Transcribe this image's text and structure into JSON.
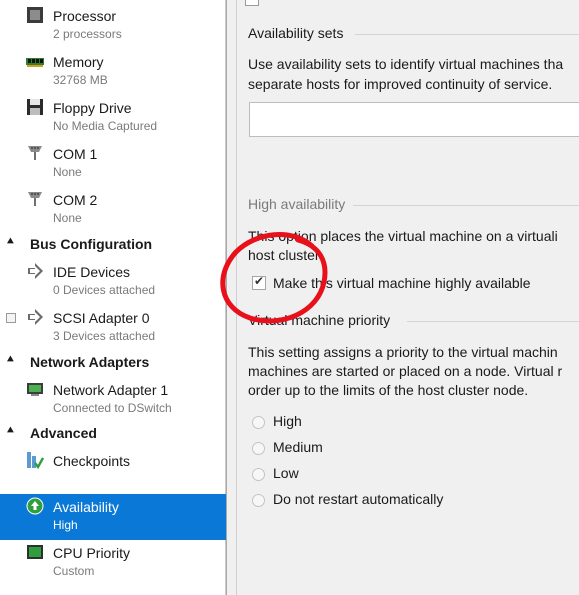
{
  "nav": {
    "processor": {
      "label": "Processor",
      "sub": "2 processors",
      "icon": "processor-icon"
    },
    "memory": {
      "label": "Memory",
      "sub": "32768 MB",
      "icon": "memory-icon"
    },
    "floppy": {
      "label": "Floppy Drive",
      "sub": "No Media Captured",
      "icon": "floppy-icon"
    },
    "com1": {
      "label": "COM 1",
      "sub": "None",
      "icon": "serial-port-icon"
    },
    "com2": {
      "label": "COM 2",
      "sub": "None",
      "icon": "serial-port-icon"
    },
    "bus_header": "Bus Configuration",
    "ide": {
      "label": "IDE Devices",
      "sub": "0 Devices attached",
      "icon": "ide-icon"
    },
    "scsi": {
      "label": "SCSI Adapter 0",
      "sub": "3 Devices attached",
      "icon": "scsi-icon"
    },
    "network_header": "Network Adapters",
    "netadapter": {
      "label": "Network Adapter 1",
      "sub": "Connected to DSwitch",
      "icon": "network-adapter-icon"
    },
    "advanced_header": "Advanced",
    "checkpoints": {
      "label": "Checkpoints",
      "sub": "",
      "icon": "checkpoints-icon"
    },
    "availability": {
      "label": "Availability",
      "sub": "High",
      "icon": "availability-icon"
    },
    "cpupriority": {
      "label": "CPU Priority",
      "sub": "Custom",
      "icon": "cpu-priority-icon"
    }
  },
  "content": {
    "availability_sets": {
      "title": "Availability sets",
      "desc_line1": "Use availability sets to identify virtual machines tha",
      "desc_line2": "separate hosts for improved continuity of service.",
      "input_value": ""
    },
    "high_availability": {
      "title": "High availability",
      "desc_line1": "This option places the virtual machine on a virtuali",
      "desc_line2": "host cluster.",
      "checkbox_label": "Make this virtual machine highly available",
      "checkbox_checked": true
    },
    "priority": {
      "title": "Virtual machine priority",
      "desc_line1": "This setting assigns a priority to the virtual machin",
      "desc_line2": "machines are started or placed on a node. Virtual r",
      "desc_line3": "order up to the limits of the host cluster node.",
      "options": [
        "High",
        "Medium",
        "Low",
        "Do not restart automatically"
      ]
    }
  },
  "colors": {
    "selection": "#0a78d7",
    "annotation": "#e8101b"
  }
}
